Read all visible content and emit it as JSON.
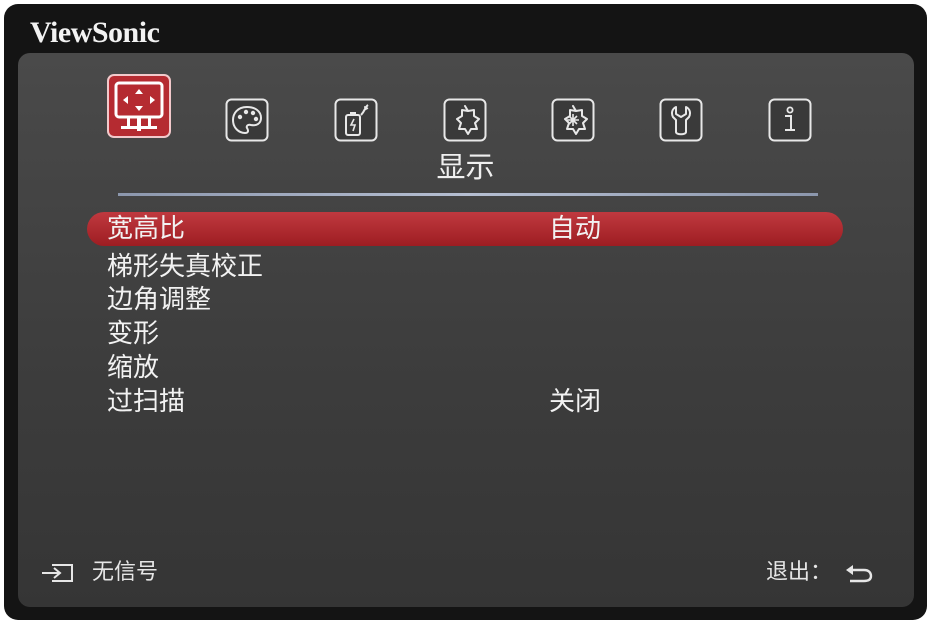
{
  "brand": "ViewSonic",
  "tabs": [
    {
      "name": "display",
      "icon": "display-icon",
      "active": true
    },
    {
      "name": "image",
      "icon": "palette-icon",
      "active": false
    },
    {
      "name": "power",
      "icon": "power-management-icon",
      "active": false
    },
    {
      "name": "basic",
      "icon": "basic-settings-gear-icon",
      "active": false
    },
    {
      "name": "advanced",
      "icon": "advanced-settings-gear-icon",
      "active": false
    },
    {
      "name": "system",
      "icon": "wrench-icon",
      "active": false
    },
    {
      "name": "info",
      "icon": "info-icon",
      "active": false
    }
  ],
  "active_tab_title": "显示",
  "menu": {
    "items": [
      {
        "label": "宽高比",
        "value": "自动",
        "selected": true
      },
      {
        "label": "梯形失真校正",
        "value": ""
      },
      {
        "label": "边角调整",
        "value": ""
      },
      {
        "label": "变形",
        "value": ""
      },
      {
        "label": "缩放",
        "value": ""
      },
      {
        "label": "过扫描",
        "value": "关闭"
      }
    ]
  },
  "footer": {
    "source_status": "无信号",
    "exit_label": "退出："
  },
  "colors": {
    "selected_row": "#b02a30",
    "panel": "#444444",
    "frame": "#141414",
    "divider": "#aab3c7"
  }
}
